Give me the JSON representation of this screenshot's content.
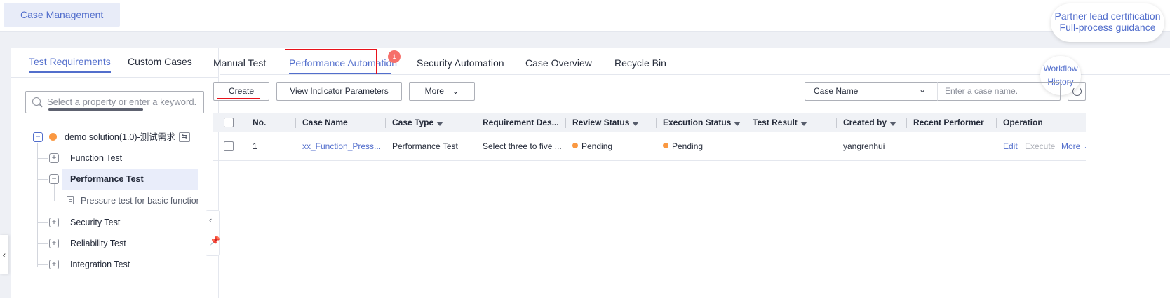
{
  "topbar": {
    "module_tab": "Case Management",
    "partner_line1": "Partner lead certification",
    "partner_line2": "Full-process guidance"
  },
  "left": {
    "tabs": [
      "Test Requirements",
      "Custom Cases"
    ],
    "search_placeholder": "Select a property or enter a keyword.",
    "tree": {
      "root": "demo solution(1.0)-测试需求",
      "items": [
        "Function Test",
        "Performance Test",
        "Security Test",
        "Reliability Test",
        "Integration Test"
      ],
      "child": "Pressure test for basic function po"
    }
  },
  "right": {
    "tabs": [
      "Manual Test",
      "Performance Automation",
      "Security Automation",
      "Case Overview",
      "Recycle Bin"
    ],
    "badge": "1",
    "workflow": [
      "Workflow",
      "History"
    ],
    "buttons": {
      "create": "Create",
      "indicator": "View Indicator Parameters",
      "more": "More"
    },
    "filter": {
      "select": "Case Name",
      "placeholder": "Enter a case name."
    },
    "table": {
      "headers": [
        "No.",
        "Case Name",
        "Case Type",
        "Requirement Des...",
        "Review Status",
        "Execution Status",
        "Test Result",
        "Created by",
        "Recent Performer",
        "Operation"
      ],
      "rows": [
        {
          "no": "1",
          "case_name": "xx_Function_Press...",
          "case_type": "Performance Test",
          "requirement": "Select three to five ...",
          "review_status": "Pending",
          "execution_status": "Pending",
          "test_result": "",
          "created_by": "yangrenhui",
          "recent_performer": "",
          "ops": [
            "Edit",
            "Execute",
            "More"
          ]
        }
      ]
    }
  },
  "colors": {
    "accent": "#526ecc",
    "pending": "#fa9841",
    "highlight_box": "#e8121b",
    "badge": "#f66f6a"
  }
}
